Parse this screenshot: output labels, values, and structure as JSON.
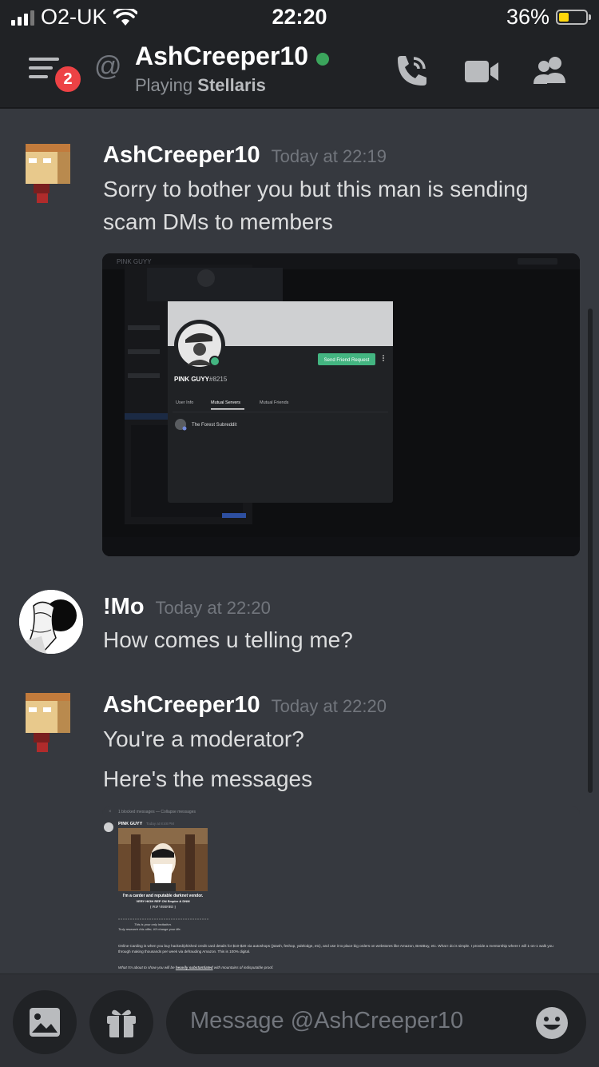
{
  "status_bar": {
    "carrier": "O2-UK",
    "time": "22:20",
    "battery": "36%",
    "battery_level": 0.36
  },
  "header": {
    "mentions_badge": "2",
    "channel_name": "AshCreeper10",
    "activity_prefix": "Playing",
    "activity_game": "Stellaris",
    "status": "online",
    "icons": [
      "hamburger-icon",
      "at-icon",
      "call-icon",
      "video-icon",
      "members-icon"
    ]
  },
  "messages": [
    {
      "author": "AshCreeper10",
      "timestamp": "Today at 22:19",
      "lines": [
        "Sorry to bother you but this man is sending",
        "scam DMs to members"
      ]
    },
    {
      "author": "!Mo",
      "timestamp": "Today at 22:20",
      "lines": [
        "How comes u telling me?"
      ]
    },
    {
      "author": "AshCreeper10",
      "timestamp": "Today at 22:20",
      "lines": [
        "You're a moderator?",
        "Here's the messages"
      ]
    }
  ],
  "screenshot1": {
    "channel_title": "PINK GUYY",
    "profile_username": "PINK GUYY",
    "profile_tag": "#8215",
    "friend_button": "Send Friend Request",
    "tabs": [
      "User Info",
      "Mutual Servers",
      "Mutual Friends"
    ],
    "mutual_server": "The Forest Subreddit"
  },
  "screenshot2": {
    "blocked_line": "1 blocked messages — Collapse messages",
    "author": "PINK GUYY",
    "time": "Today at 8:48 PM",
    "line1": "I'm a carder and reputable darknet vendor.",
    "line2": "VERY HIGH REP ON Empire & DNM",
    "line3": "⟦ PGP VERIFIED ⟧",
    "line4": "This is your only invitation.",
    "line5": "Truly research this offer, it'll change your life.",
    "para1": "Online Carding is when you buy hacked/phished credit card details for $10-$20 via autoshops (jstash, feshop, yalelodge, etc), and use it to place big orders on webstores like Amazon, BestBuy, etc. What I do is simple. I provide a mentorship where I will 1-on-1 walk you through making thousands per week via defrauding Amazon. This is 100% digital.",
    "para2_prefix": "What I'm about to show you will be",
    "para2_bold": "heavily substantiated",
    "para2_suffix": "with mountains of indisputable proof."
  },
  "composer": {
    "placeholder": "Message @AshCreeper10",
    "icons": [
      "image-icon",
      "gift-icon",
      "emoji-icon"
    ]
  },
  "colors": {
    "background": "#36393f",
    "header": "#202225",
    "online": "#3ba55c",
    "badge": "#ed4245",
    "friend_button": "#43b581",
    "battery": "#ffd60a"
  }
}
